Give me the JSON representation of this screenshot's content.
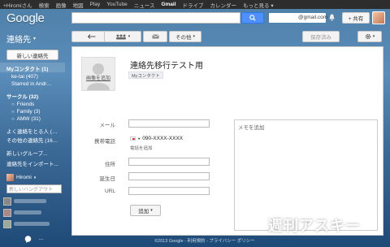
{
  "topbar": {
    "items": [
      "+Hiromiさん",
      "検索",
      "画像",
      "地図",
      "Play",
      "YouTube",
      "ニュース",
      "Gmail",
      "ドライブ",
      "カレンダー",
      "もっと見る ▾"
    ],
    "active_index": 7
  },
  "header": {
    "logo": "Google",
    "email_suffix": "@gmail.com",
    "share_label": "+ 共有"
  },
  "app": {
    "title": "連絡先",
    "title_caret": "▾"
  },
  "toolbar": {
    "other_label": "その他",
    "save_label": "保存済み"
  },
  "sidebar": {
    "new_contact": "新しい連絡先",
    "items": [
      {
        "label": "Myコンタクト (1)",
        "style": "bold"
      },
      {
        "label": "ke-tai (407)",
        "style": "sub"
      },
      {
        "label": "Starred in Andr…",
        "style": "sub"
      },
      {
        "label": "サークル (32)",
        "style": "bold"
      },
      {
        "label": "Friends",
        "style": "circle"
      },
      {
        "label": "Family (3)",
        "style": "circle"
      },
      {
        "label": "AMW (31)",
        "style": "circle"
      },
      {
        "label": "よく連絡をとる人 (…",
        "style": "plain"
      },
      {
        "label": "その他の連絡先 (16…",
        "style": "plain"
      },
      {
        "label": "新しいグループ...",
        "style": "plain"
      },
      {
        "label": "連絡先をインポート...",
        "style": "plain"
      }
    ],
    "hangout_user": "Hiromi",
    "hangout_placeholder": "新しいハングアウト"
  },
  "contact": {
    "photo_label": "画像を追加",
    "name": "連絡先移行テスト用",
    "group_chip": "Myコンタクト",
    "fields": {
      "email": "メール",
      "mobile": "携帯電話",
      "address": "住所",
      "birthday": "誕生日",
      "url": "URL"
    },
    "phone_number": "090-XXXX-XXXX",
    "phone_add": "電話を追加",
    "memo_placeholder": "メモを追加",
    "add_label": "追加"
  },
  "footer": "©2013 Google - 利用規約 - プライバシー ポリシー",
  "watermark": "週刊アスキー",
  "colors": {
    "search_button": "#4d90fe",
    "topbar": "#2d2d2d"
  }
}
